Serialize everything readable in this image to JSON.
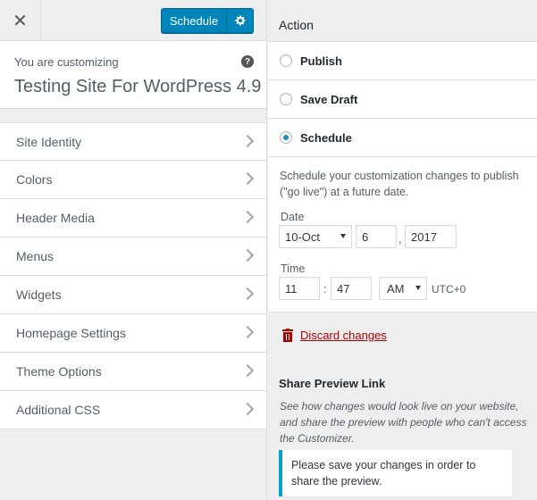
{
  "header": {
    "close_glyph": "✕",
    "schedule_label": "Schedule"
  },
  "info": {
    "pre_title": "You are customizing",
    "site_title": "Testing Site For WordPress 4.9",
    "help_glyph": "?"
  },
  "sections": [
    {
      "label": "Site Identity"
    },
    {
      "label": "Colors"
    },
    {
      "label": "Header Media"
    },
    {
      "label": "Menus"
    },
    {
      "label": "Widgets"
    },
    {
      "label": "Homepage Settings"
    },
    {
      "label": "Theme Options"
    },
    {
      "label": "Additional CSS"
    }
  ],
  "actions": {
    "heading": "Action",
    "options": [
      {
        "label": "Publish",
        "selected": false
      },
      {
        "label": "Save Draft",
        "selected": false
      },
      {
        "label": "Schedule",
        "selected": true
      }
    ]
  },
  "schedule": {
    "description": "Schedule your customization changes to publish (\"go live\") at a future date.",
    "date_label": "Date",
    "month": "10-Oct",
    "day": "6",
    "day_sep": ",",
    "year": "2017",
    "time_label": "Time",
    "hour": "11",
    "time_sep": ":",
    "minute": "47",
    "ampm": "AM",
    "timezone": "UTC+0"
  },
  "discard": {
    "label": "Discard changes"
  },
  "share": {
    "heading": "Share Preview Link",
    "description": "See how changes would look live on your website, and share the preview with people who can't access the Customizer.",
    "notice": "Please save your changes in order to share the preview."
  },
  "colors": {
    "primary_button": "#0085ba",
    "radio_selected": "#1e8cbe",
    "danger": "#aa0000",
    "notice_border": "#00a0d2"
  }
}
